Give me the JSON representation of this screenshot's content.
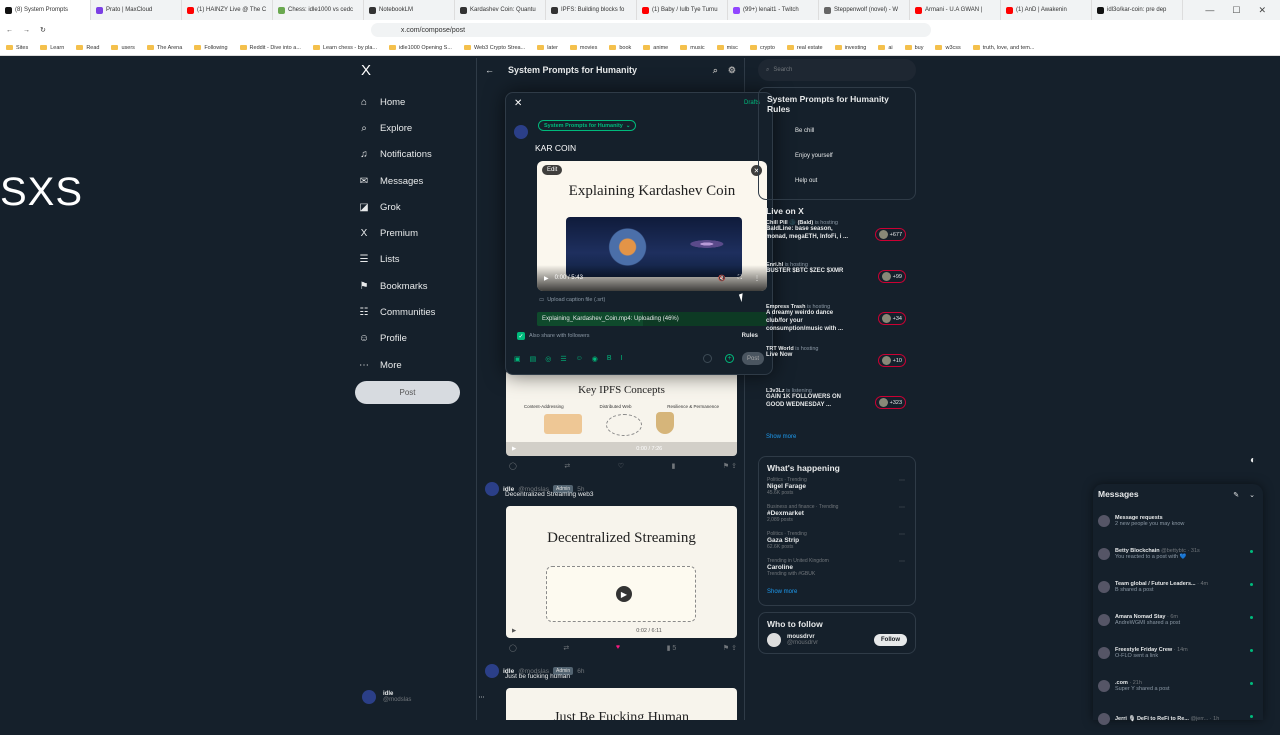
{
  "browser": {
    "tabs": [
      {
        "label": "(8) System Prompts",
        "color": "#111111"
      },
      {
        "label": "Prato | MaxCloud",
        "color": "#7b3fe4"
      },
      {
        "label": "(1) HAINZY Live @ The C",
        "color": "#ff0000"
      },
      {
        "label": "Chess: idle1000 vs cedc",
        "color": "#6aa84f"
      },
      {
        "label": "NotebookLM",
        "color": "#333333"
      },
      {
        "label": "Kardashev Coin: Quantu",
        "color": "#333333"
      },
      {
        "label": "IPFS: Building blocks fo",
        "color": "#333333"
      },
      {
        "label": "(1) Baby / Iulb Tye Turnu",
        "color": "#ff0000"
      },
      {
        "label": "(99+) lenait1 - Twitch",
        "color": "#9146ff"
      },
      {
        "label": "Steppenwolf (novel) - W",
        "color": "#666666"
      },
      {
        "label": "Armani - U.A GWAN | ",
        "color": "#ff0000"
      },
      {
        "label": "(1) AnD | Awakenin",
        "color": "#ff0000"
      },
      {
        "label": "idl3o/kar-coin: pre dep",
        "color": "#111111"
      }
    ],
    "url": "x.com/compose/post",
    "bookmarks": [
      "Sites",
      "Learn",
      "Read",
      "users",
      "The Arena",
      "Following",
      "Reddit - Dive into a...",
      "Learn chess - by pla...",
      "idle1000 Opening S...",
      "Web3 Crypto Strea...",
      "later",
      "movies",
      "book",
      "anime",
      "music",
      "misc",
      "crypto",
      "real estate",
      "investing",
      "ai",
      "buy",
      "w3css",
      "truth, love, and tem..."
    ]
  },
  "overlay_text": "SXS",
  "nav": {
    "logo": "X",
    "items": [
      {
        "label": "Home",
        "icon": "⌂"
      },
      {
        "label": "Explore",
        "icon": "⌕"
      },
      {
        "label": "Notifications",
        "icon": "♫"
      },
      {
        "label": "Messages",
        "icon": "✉"
      },
      {
        "label": "Grok",
        "icon": "◪"
      },
      {
        "label": "Premium",
        "icon": "X"
      },
      {
        "label": "Lists",
        "icon": "☰"
      },
      {
        "label": "Bookmarks",
        "icon": "⚑"
      },
      {
        "label": "Communities",
        "icon": "☷"
      },
      {
        "label": "Profile",
        "icon": "☺"
      },
      {
        "label": "More",
        "icon": "⋯"
      }
    ],
    "post_label": "Post",
    "user_name": "idle",
    "user_handle": "@modslas"
  },
  "timeline": {
    "title": "System Prompts for Humanity",
    "post1": {
      "media_title": "Key IPFS Concepts",
      "time": "0:00 / 7:26",
      "labels": [
        "Content-Addressing",
        "Distributed Web",
        "Resilience & Permanence"
      ]
    },
    "post2": {
      "name": "idle",
      "handle": "@modslas",
      "badge": "Admin",
      "time": "5h",
      "text": "Decentralized Streaming web3",
      "media_title": "Decentralized Streaming",
      "video_time": "0:02 / 6:11",
      "views": "5"
    },
    "post3": {
      "name": "idle",
      "handle": "@modslas",
      "badge": "Admin",
      "time": "6h",
      "text": "Just be fucking human",
      "media_title": "Just Be Fucking Human"
    }
  },
  "compose": {
    "drafts": "Drafts",
    "community": "System Prompts for Humanity",
    "text": "KAR COIN",
    "video_title": "Explaining Kardashev Coin",
    "edit": "Edit",
    "video_time": "0:00 / 5:43",
    "caption_label": "Upload caption file (.srt)",
    "upload_status": "Explaining_Kardashev_Coin.mp4: Uploading (46%)",
    "upload_progress": 0.46,
    "share_label": "Also share with followers",
    "rules": "Rules",
    "post_label": "Post",
    "accent": "#00ba7c"
  },
  "right": {
    "search_placeholder": "Search",
    "rules_title": "System Prompts for Humanity Rules",
    "rules": [
      "Be chill",
      "Enjoy yourself",
      "Help out"
    ],
    "live_title": "Live on X",
    "live": [
      {
        "host": "Chill Pill 🌑 (Bald)",
        "status": "is hosting",
        "title": "BaldLine: base season, monad, megaETH, InfoFi, i ...",
        "count": "+677"
      },
      {
        "host": "Enri.hl",
        "status": "is hosting",
        "title": "BUSTER $BTC $ZEC $XMR",
        "count": "+99"
      },
      {
        "host": "Empress Trash",
        "status": "is hosting",
        "title": "A dreamy weirdo dance club/for your consumption/music with ...",
        "count": "+34"
      },
      {
        "host": "TRT World",
        "status": "is hosting",
        "title": "Live Now",
        "count": "+10"
      },
      {
        "host": "L3v3Lz",
        "status": "is listening",
        "title": "GAIN 1K FOLLOWERS ON GOOD WEDNESDAY ...",
        "count": "+323"
      }
    ],
    "show_more": "Show more",
    "happening_title": "What's happening",
    "trends": [
      {
        "cat": "Politics · Trending",
        "name": "Nigel Farage",
        "posts": "45.6K posts"
      },
      {
        "cat": "Business and finance · Trending",
        "name": "#Dexmarket",
        "posts": "2,089 posts"
      },
      {
        "cat": "Politics · Trending",
        "name": "Gaza Strip",
        "posts": "62.6K posts"
      },
      {
        "cat": "Trending in United Kingdom",
        "name": "Caroline",
        "posts": "Trending with #GBUK"
      }
    ],
    "wtf_title": "Who to follow",
    "wtf_name": "mousdrvr",
    "wtf_handle": "@mousdrvr",
    "follow_label": "Follow"
  },
  "messages": {
    "title": "Messages",
    "rows": [
      {
        "name": "Message requests",
        "handle": "",
        "text": "2 new people you may know"
      },
      {
        "name": "Betty Blockchain",
        "handle": "@bettybtc · 31s",
        "text": "You reacted to a post with 💙"
      },
      {
        "name": "Team global / Future Leaders...",
        "handle": "· 4m",
        "text": "B shared a post"
      },
      {
        "name": "Amara Nomad Stay",
        "handle": "· 6m",
        "text": "AndreWGMI shared a post"
      },
      {
        "name": "Freestyle Friday Crew",
        "handle": "· 14m",
        "text": "O-FLO sent a link"
      },
      {
        "name": ".com",
        "handle": "· 21h",
        "text": "Super Y shared a post"
      },
      {
        "name": "Jerri 🎙 DeFi to ReFi to Re...",
        "handle": "@jerr... · 1h",
        "text": ""
      }
    ]
  }
}
